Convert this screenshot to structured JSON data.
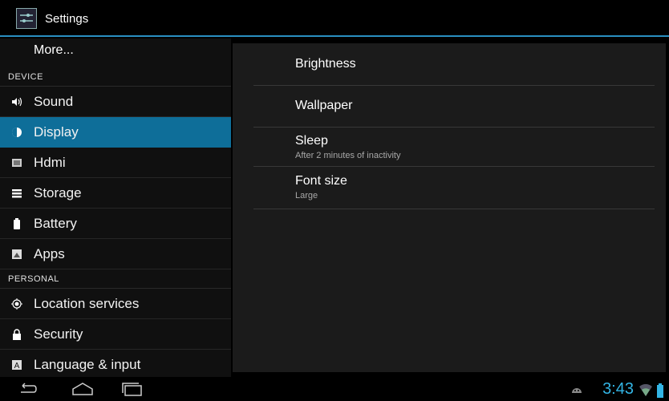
{
  "app": {
    "title": "Settings",
    "icon": "settings-sliders-icon"
  },
  "sidebar": {
    "more": "More...",
    "headers": {
      "device": "DEVICE",
      "personal": "PERSONAL"
    },
    "items": [
      {
        "label": "Sound",
        "icon": "speaker-icon"
      },
      {
        "label": "Display",
        "icon": "brightness-icon",
        "selected": true
      },
      {
        "label": "Hdmi",
        "icon": "hdmi-icon"
      },
      {
        "label": "Storage",
        "icon": "storage-icon"
      },
      {
        "label": "Battery",
        "icon": "battery-icon"
      },
      {
        "label": "Apps",
        "icon": "apps-icon"
      },
      {
        "label": "Location services",
        "icon": "location-icon"
      },
      {
        "label": "Security",
        "icon": "lock-icon"
      },
      {
        "label": "Language & input",
        "icon": "language-icon"
      }
    ]
  },
  "display_settings": [
    {
      "title": "Brightness",
      "subtitle": ""
    },
    {
      "title": "Wallpaper",
      "subtitle": ""
    },
    {
      "title": "Sleep",
      "subtitle": "After 2 minutes of inactivity"
    },
    {
      "title": "Font size",
      "subtitle": "Large"
    }
  ],
  "statusbar": {
    "time": "3:43"
  },
  "colors": {
    "accent": "#33b5e5",
    "selected": "#0e6e99"
  }
}
